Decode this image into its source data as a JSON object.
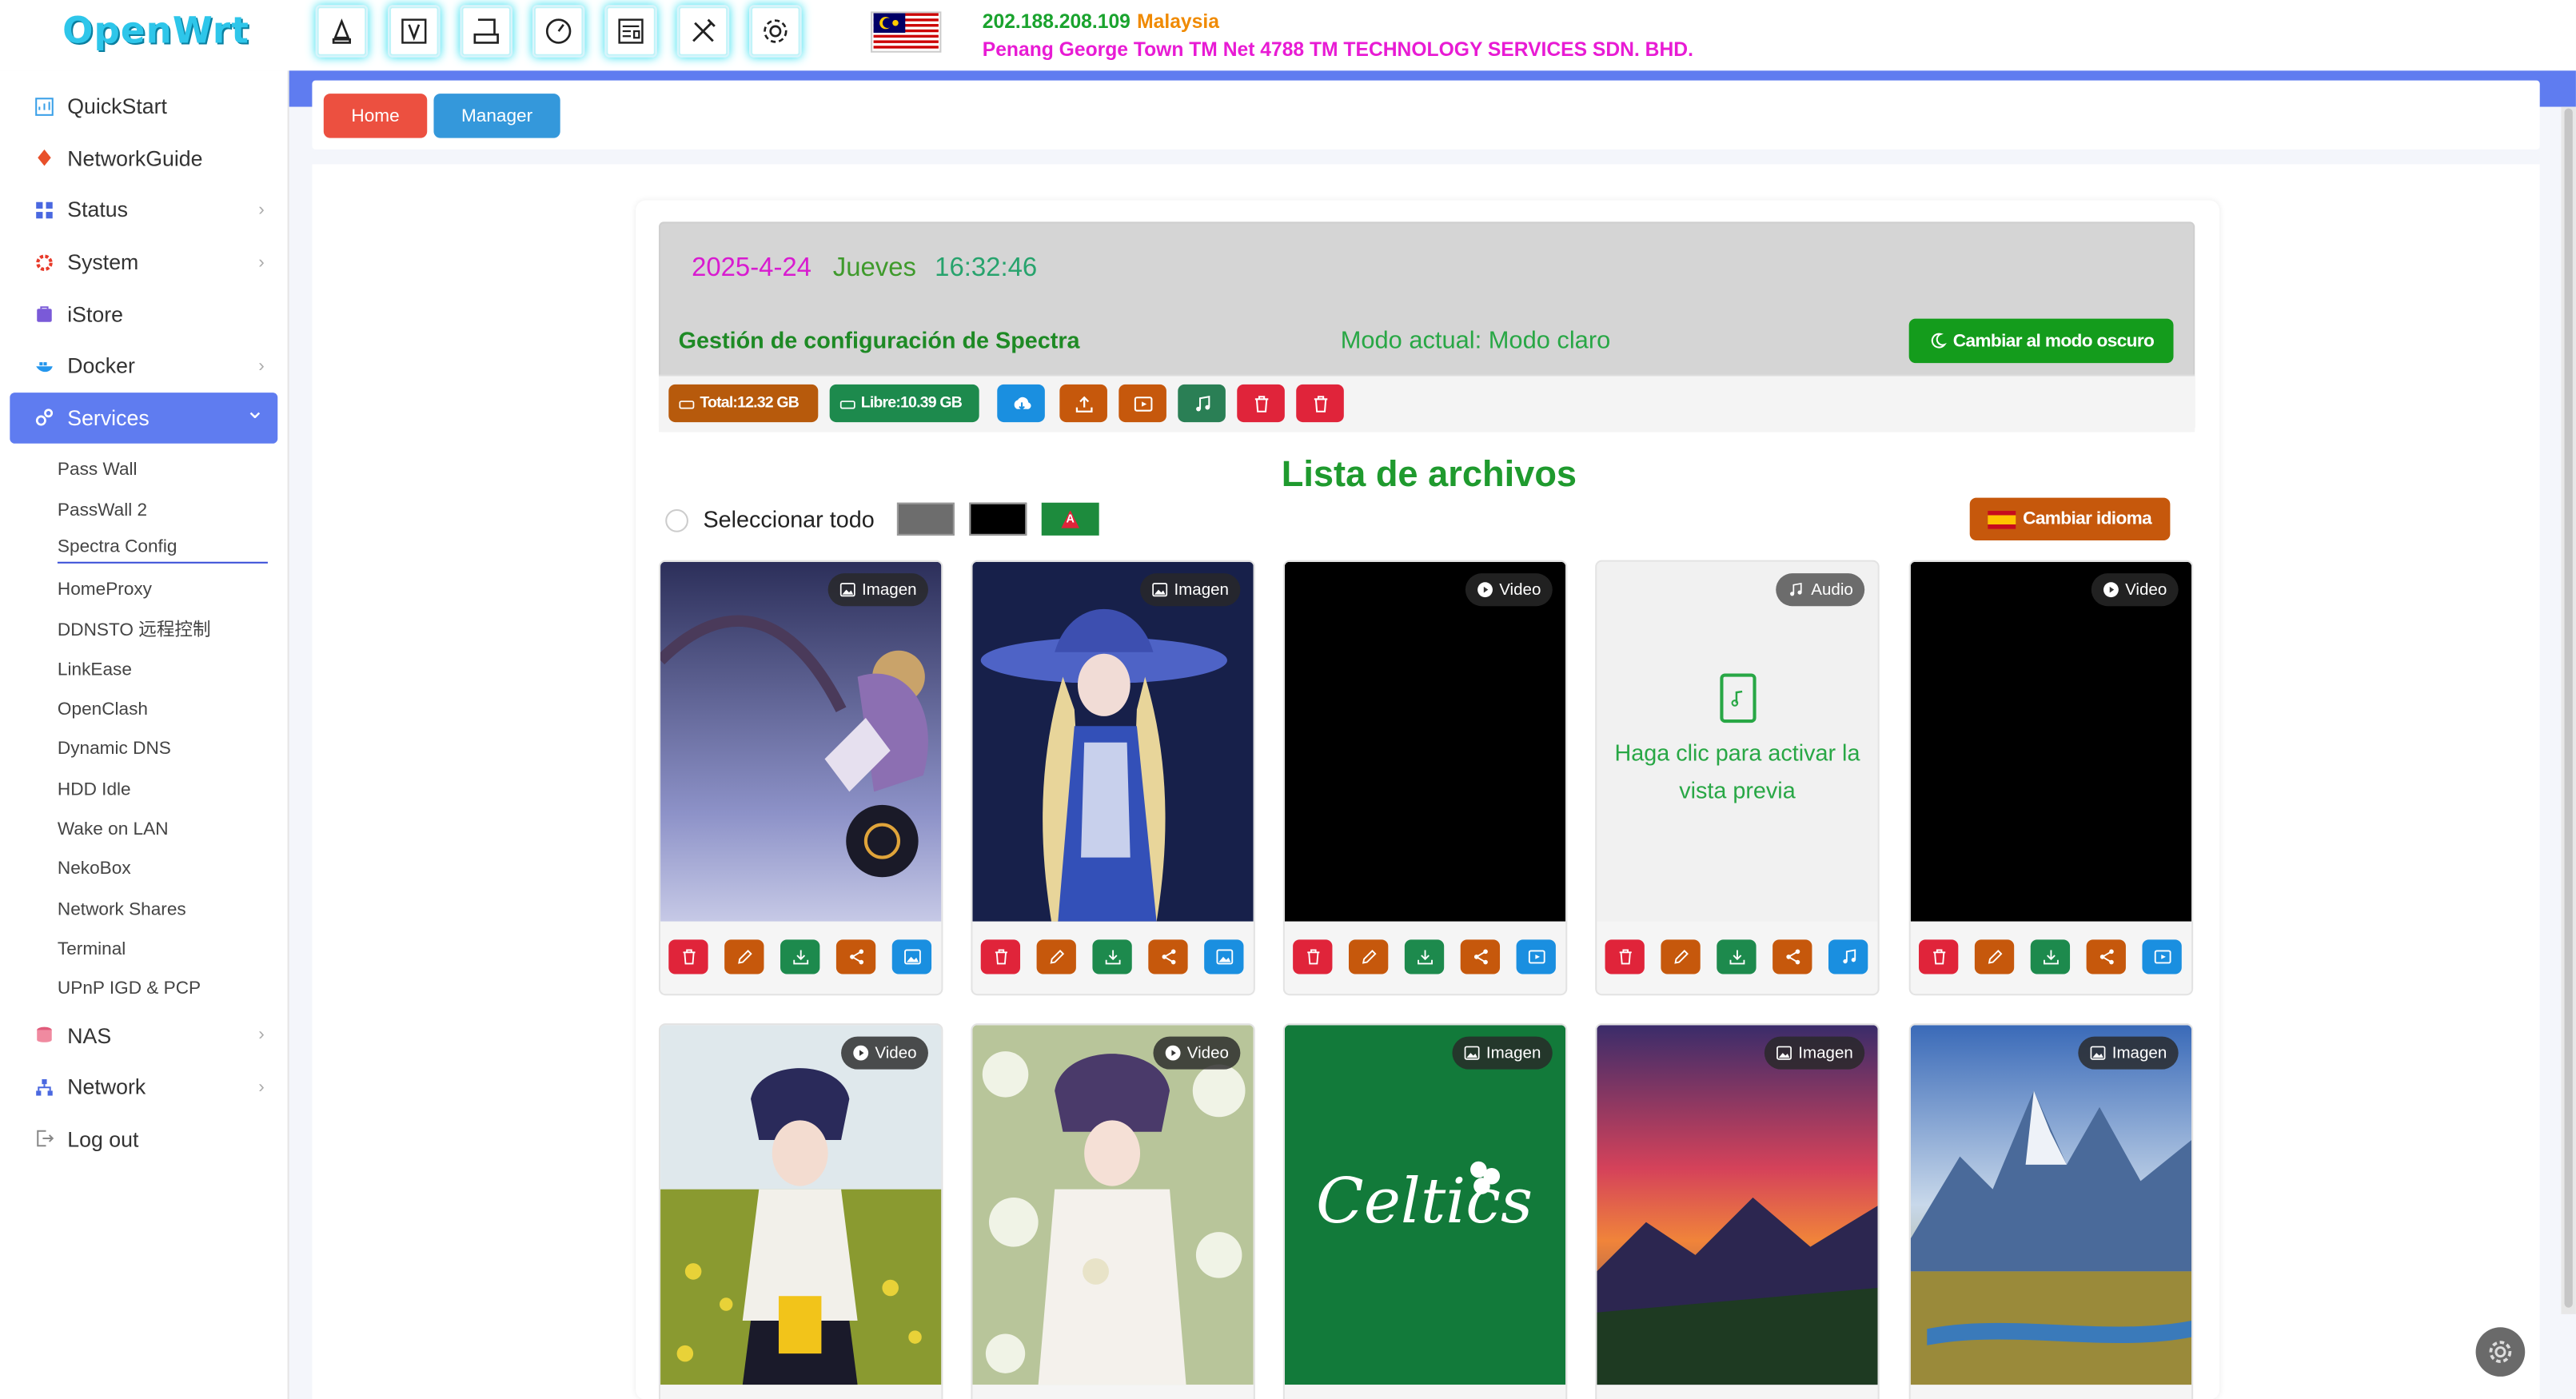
{
  "app": {
    "logo": "OpenWrt"
  },
  "top_tools": [
    "clean-icon",
    "v2ray-icon",
    "disk-icon",
    "speed-gauge-icon",
    "dashboard-icon",
    "tools-icon",
    "settings-icon"
  ],
  "ipinfo": {
    "ip": "202.188.208.109",
    "country": "Malaysia",
    "isp": "Penang George Town TM Net 4788 TM TECHNOLOGY SERVICES SDN. BHD."
  },
  "sidebar": {
    "items": [
      {
        "label": "QuickStart",
        "icon": "quickstart-icon",
        "chevron": false
      },
      {
        "label": "NetworkGuide",
        "icon": "guide-icon",
        "chevron": false
      },
      {
        "label": "Status",
        "icon": "status-icon",
        "chevron": true
      },
      {
        "label": "System",
        "icon": "system-icon",
        "chevron": true
      },
      {
        "label": "iStore",
        "icon": "store-icon",
        "chevron": false
      },
      {
        "label": "Docker",
        "icon": "docker-icon",
        "chevron": true
      },
      {
        "label": "Services",
        "icon": "services-icon",
        "chevron": true,
        "active": true
      }
    ],
    "services_sub": [
      "Pass Wall",
      "PassWall 2",
      "Spectra Config",
      "HomeProxy",
      "DDNSTO 远程控制",
      "LinkEase",
      "OpenClash",
      "Dynamic DNS",
      "HDD Idle",
      "Wake on LAN",
      "NekoBox",
      "Network Shares",
      "Terminal",
      "UPnP IGD & PCP"
    ],
    "items_after": [
      {
        "label": "NAS",
        "icon": "nas-icon",
        "chevron": true
      },
      {
        "label": "Network",
        "icon": "network-icon",
        "chevron": true
      },
      {
        "label": "Log out",
        "icon": "logout-icon",
        "chevron": false
      }
    ]
  },
  "breadcrumb": {
    "home": "Home",
    "manager": "Manager"
  },
  "header": {
    "date": "2025-4-24",
    "weekday": "Jueves",
    "time": "16:32:46",
    "config_title": "Gestión de configuración de Spectra",
    "mode_text": "Modo actual: Modo claro",
    "dark_mode_button": "Cambiar al modo oscuro"
  },
  "storage": {
    "total": "Total:12.32 GB",
    "free": "Libre:10.39 GB"
  },
  "file_list": {
    "title": "Lista de archivos",
    "select_all": "Seleccionar todo",
    "lang_button": "Cambiar idioma",
    "cards": [
      {
        "type": "Imagen",
        "kind": "image",
        "last_action": "image"
      },
      {
        "type": "Imagen",
        "kind": "image",
        "last_action": "image"
      },
      {
        "type": "Video",
        "kind": "video",
        "last_action": "video"
      },
      {
        "type": "Audio",
        "kind": "audio",
        "last_action": "audio",
        "preview_text": "Haga clic para activar la vista previa"
      },
      {
        "type": "Video",
        "kind": "video",
        "last_action": "video"
      },
      {
        "type": "Video",
        "kind": "video"
      },
      {
        "type": "Video",
        "kind": "video"
      },
      {
        "type": "Imagen",
        "kind": "image",
        "art_text": "Celtics"
      },
      {
        "type": "Imagen",
        "kind": "image"
      },
      {
        "type": "Imagen",
        "kind": "image"
      }
    ]
  },
  "colors": {
    "accent": "#5f7cf0",
    "green": "#1d8a4d",
    "orange": "#c6580c",
    "red": "#e0243a",
    "blue": "#1a8fe0"
  }
}
